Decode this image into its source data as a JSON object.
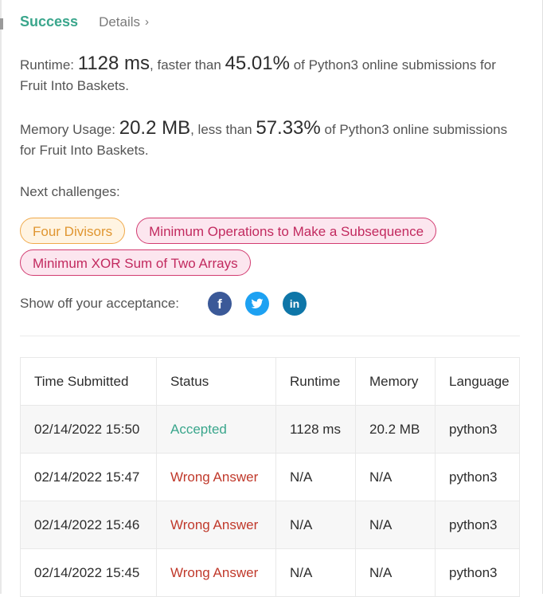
{
  "header": {
    "status": "Success",
    "details_label": "Details"
  },
  "runtime": {
    "label": "Runtime:",
    "value": "1128 ms",
    "middle": ", faster than",
    "percent": "45.01%",
    "suffix": "of Python3 online submissions for Fruit Into Baskets."
  },
  "memory": {
    "label": "Memory Usage:",
    "value": "20.2 MB",
    "middle": ", less than",
    "percent": "57.33%",
    "suffix": "of Python3 online submissions for Fruit Into Baskets."
  },
  "next": {
    "label": "Next challenges:",
    "challenges": [
      {
        "title": "Four Divisors",
        "difficulty": "medium"
      },
      {
        "title": "Minimum Operations to Make a Subsequence",
        "difficulty": "hard"
      },
      {
        "title": "Minimum XOR Sum of Two Arrays",
        "difficulty": "hard"
      }
    ]
  },
  "share": {
    "label": "Show off your acceptance:",
    "icons": [
      "facebook-icon",
      "twitter-icon",
      "linkedin-icon"
    ]
  },
  "colors": {
    "accent": "#3aa68c",
    "medium": "#e09631",
    "hard": "#c22a5f",
    "error": "#c0392b"
  },
  "table": {
    "headers": [
      "Time Submitted",
      "Status",
      "Runtime",
      "Memory",
      "Language"
    ],
    "rows": [
      {
        "time": "02/14/2022 15:50",
        "status": "Accepted",
        "status_type": "accepted",
        "runtime": "1128 ms",
        "memory": "20.2 MB",
        "language": "python3"
      },
      {
        "time": "02/14/2022 15:47",
        "status": "Wrong Answer",
        "status_type": "wrong",
        "runtime": "N/A",
        "memory": "N/A",
        "language": "python3"
      },
      {
        "time": "02/14/2022 15:46",
        "status": "Wrong Answer",
        "status_type": "wrong",
        "runtime": "N/A",
        "memory": "N/A",
        "language": "python3"
      },
      {
        "time": "02/14/2022 15:45",
        "status": "Wrong Answer",
        "status_type": "wrong",
        "runtime": "N/A",
        "memory": "N/A",
        "language": "python3"
      }
    ]
  }
}
